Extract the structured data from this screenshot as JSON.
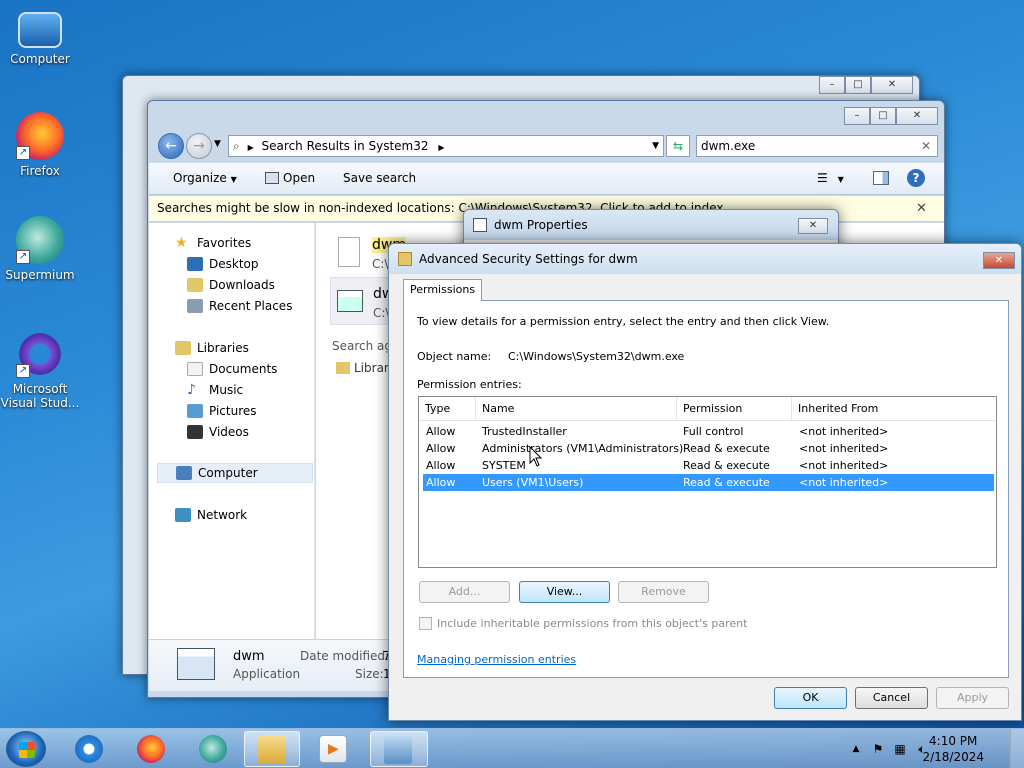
{
  "desktop": {
    "icons": [
      {
        "label": "Computer"
      },
      {
        "label": "Firefox"
      },
      {
        "label": "Supermium"
      },
      {
        "label": "Microsoft Visual Stud..."
      }
    ]
  },
  "explorer": {
    "breadcrumb": "Search Results in System32",
    "search_value": "dwm.exe",
    "toolbar": {
      "organize": "Organize",
      "open": "Open",
      "save_search": "Save search"
    },
    "info_bar": "Searches might be slow in non-indexed locations: C:\\Windows\\System32. Click to add to index...",
    "favorites": "Favorites",
    "fav_items": [
      "Desktop",
      "Downloads",
      "Recent Places"
    ],
    "libraries": "Libraries",
    "lib_items": [
      "Documents",
      "Music",
      "Pictures",
      "Videos"
    ],
    "computer": "Computer",
    "network": "Network",
    "results": [
      {
        "name": "dwm",
        "path": "C:\\"
      },
      {
        "name": "dw",
        "path": "C:\\"
      }
    ],
    "search_again": "Search aga",
    "libraries_short": "Librari",
    "details": {
      "name": "dwm",
      "type": "Application",
      "date_label": "Date modified:",
      "date_value": "7",
      "size_label": "Size:",
      "size_value": "1"
    }
  },
  "properties": {
    "title": "dwm Properties"
  },
  "security": {
    "title": "Advanced Security Settings for dwm",
    "tab": "Permissions",
    "instruction": "To view details for a permission entry, select the entry and then click View.",
    "object_label": "Object name:",
    "object_value": "C:\\Windows\\System32\\dwm.exe",
    "entries_label": "Permission entries:",
    "columns": [
      "Type",
      "Name",
      "Permission",
      "Inherited From"
    ],
    "rows": [
      {
        "type": "Allow",
        "name": "TrustedInstaller",
        "permission": "Full control",
        "inherited": "<not inherited>"
      },
      {
        "type": "Allow",
        "name": "Administrators (VM1\\Administrators)",
        "permission": "Read & execute",
        "inherited": "<not inherited>"
      },
      {
        "type": "Allow",
        "name": "SYSTEM",
        "permission": "Read & execute",
        "inherited": "<not inherited>"
      },
      {
        "type": "Allow",
        "name": "Users (VM1\\Users)",
        "permission": "Read & execute",
        "inherited": "<not inherited>"
      }
    ],
    "selected_row": 3,
    "buttons": {
      "add": "Add...",
      "view": "View...",
      "remove": "Remove"
    },
    "include_inheritable": "Include inheritable permissions from this object's parent",
    "manage_link": "Managing permission entries",
    "ok": "OK",
    "cancel": "Cancel",
    "apply": "Apply"
  },
  "taskbar": {
    "time": "4:10 PM",
    "date": "2/18/2024"
  }
}
